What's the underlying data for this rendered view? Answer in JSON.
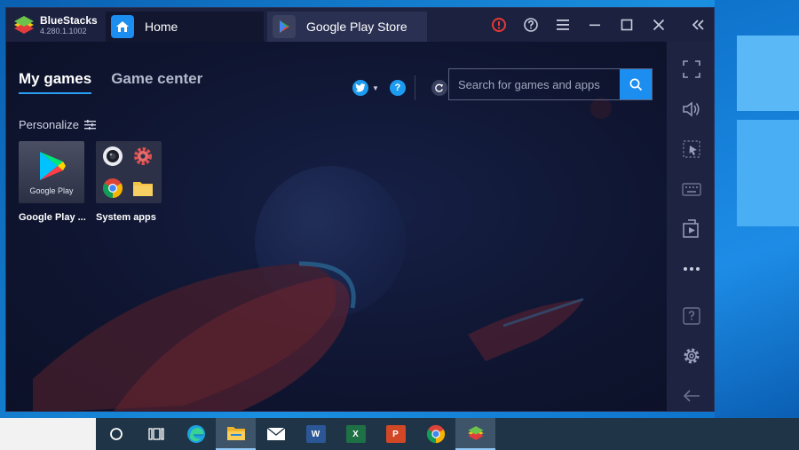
{
  "app": {
    "name": "BlueStacks",
    "version": "4.280.1.1002"
  },
  "tabs": [
    {
      "label": "Home",
      "icon": "home-icon"
    },
    {
      "label": "Google Play Store",
      "icon": "play-store-icon"
    }
  ],
  "title_controls": [
    "alert-icon",
    "help-circle-icon",
    "menu-icon",
    "minimize-icon",
    "maximize-icon",
    "close-icon",
    "collapse-sidebar-icon"
  ],
  "nav": {
    "my_games": "My games",
    "game_center": "Game center"
  },
  "toolbar": {
    "icons": [
      "twitter-icon",
      "help-icon",
      "refresh-icon"
    ]
  },
  "search": {
    "placeholder": "Search for games and apps",
    "value": ""
  },
  "personalize_label": "Personalize",
  "games": [
    {
      "label": "Google Play ...",
      "tile_text": "Google Play",
      "icon": "google-play-icon"
    },
    {
      "label": "System apps",
      "icons": [
        "camera-icon",
        "settings-icon",
        "chrome-icon",
        "files-icon"
      ]
    }
  ],
  "sidebar": [
    "fullscreen-icon",
    "volume-icon",
    "pointer-icon",
    "keyboard-icon",
    "media-icon",
    "more-icon",
    "help-icon",
    "settings-icon",
    "back-icon"
  ],
  "taskbar": [
    "cortana-icon",
    "task-view-icon",
    "edge-icon",
    "file-explorer-icon",
    "mail-icon",
    "word-icon",
    "excel-icon",
    "powerpoint-icon",
    "chrome-icon",
    "bluestacks-icon"
  ],
  "colors": {
    "accent": "#1c8ef0",
    "window_bg": "#141a33",
    "sidebar_bg": "#1e2342",
    "taskbar_bg": "#1f3446"
  }
}
